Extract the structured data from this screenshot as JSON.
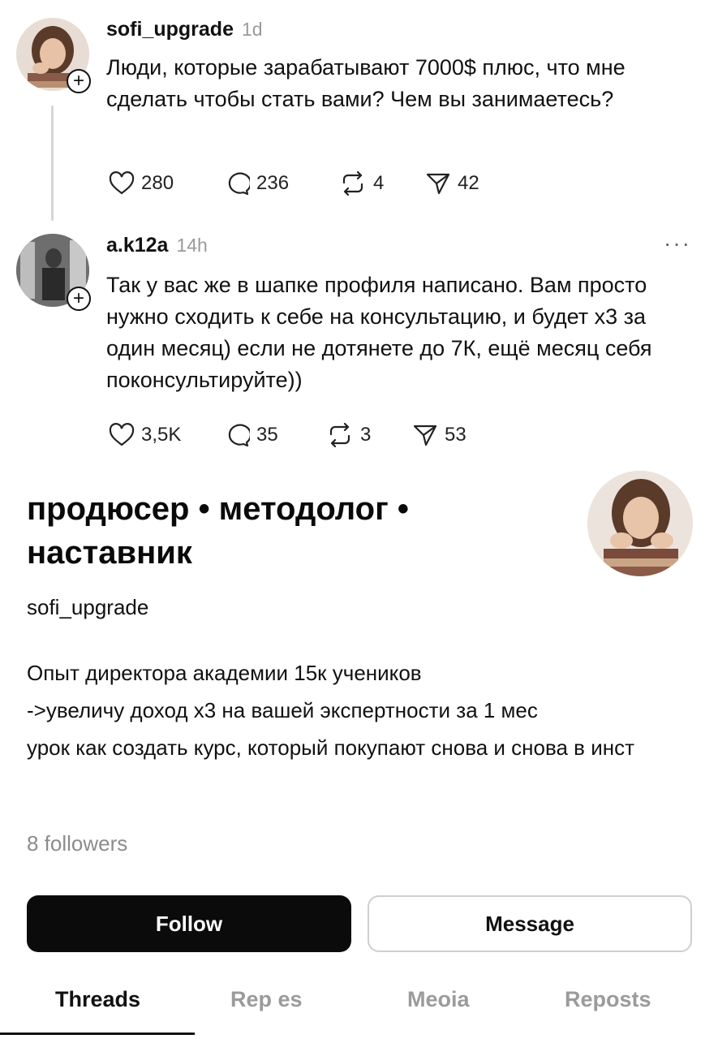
{
  "posts": [
    {
      "username": "sofi_upgrade",
      "time": "1d",
      "text": "Люди, которые зарабатывают 7000$ плюс, что мне сделать чтобы стать вами? Чем вы занимаетесь?",
      "likes": "280",
      "replies": "236",
      "reposts": "4",
      "shares": "42",
      "plus": "+"
    },
    {
      "username": "a.k12a",
      "time": "14h",
      "more": "···",
      "text": "Так у вас же в шапке профиля написано. Вам просто нужно сходить к себе на консультацию, и будет х3 за один месяц) если не дотянете до 7К, ещё месяц себя поконсультируйте))",
      "likes": "3,5K",
      "replies": "35",
      "reposts": "3",
      "shares": "53",
      "plus": "+"
    }
  ],
  "profile": {
    "name": "продюсер • методолог • наставник",
    "handle": "sofi_upgrade",
    "bio": [
      "Опыт директора академии 15к учеников",
      "->увеличу доход х3 на вашей экспертности за 1 мес",
      "урок как создать курс, который покупают снова и снова в инст"
    ],
    "followers": "8 followers",
    "follow_label": "Follow",
    "message_label": "Message"
  },
  "tabs": [
    "Threads",
    "Rep  es",
    "Meoia",
    "Reposts"
  ],
  "active_tab": "Threads",
  "icons": {
    "like": "heart-icon",
    "reply": "comment-icon",
    "repost": "repost-icon",
    "share": "send-icon"
  }
}
